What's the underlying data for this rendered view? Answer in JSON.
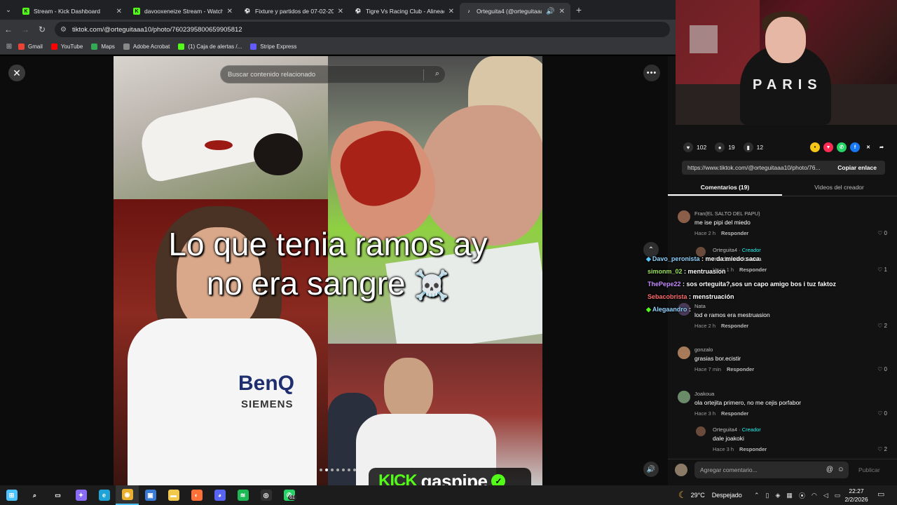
{
  "browser": {
    "tabs": [
      {
        "title": "Stream - Kick Dashboard",
        "favicon": "kick-icon",
        "color": "#53fc18",
        "active": false
      },
      {
        "title": "davooxeneize Stream - Watch L",
        "favicon": "kick-icon",
        "color": "#53fc18",
        "active": false
      },
      {
        "title": "Fixture y partidos de 07-02-202",
        "favicon": "soccer-icon",
        "color": "#3fb950",
        "active": false
      },
      {
        "title": "Tigre Vs Racing Club - Alineaci",
        "favicon": "soccer-icon",
        "color": "#3fb950",
        "active": false
      },
      {
        "title": "Orteguita4 (@orteguitaaa1(",
        "favicon": "tiktok-icon",
        "color": "#ffffff",
        "active": true
      }
    ],
    "url": "tiktok.com/@orteguitaaa10/photo/7602395800659905812",
    "bookmarks": [
      {
        "label": "Gmail",
        "color": "#ea4335"
      },
      {
        "label": "YouTube",
        "color": "#ff0000"
      },
      {
        "label": "Maps",
        "color": "#34a853"
      },
      {
        "label": "Adobe Acrobat",
        "color": "#888888"
      },
      {
        "label": "(1) Caja de alertas /...",
        "color": "#53fc18"
      },
      {
        "label": "Stripe Express",
        "color": "#635bff"
      }
    ]
  },
  "viewer": {
    "search_placeholder": "Buscar contenido relacionado",
    "caption_line1": "Lo que tenia ramos ay",
    "caption_line2": "no era sangre",
    "caption_emoji": "☠️",
    "jersey_sponsor": "BenQ",
    "jersey_sponsor2": "SIEMENS",
    "carousel_count": 7,
    "carousel_active": 1
  },
  "actions": {
    "likes": "102",
    "comments": "19",
    "saves": "12",
    "share_targets": [
      {
        "name": "coin-icon",
        "color": "#f5c518",
        "glyph": "•"
      },
      {
        "name": "tiktok-share-icon",
        "color": "#fe2c55",
        "glyph": "▼"
      },
      {
        "name": "whatsapp-icon",
        "color": "#25d366",
        "glyph": "✆"
      },
      {
        "name": "facebook-icon",
        "color": "#1877f2",
        "glyph": "f"
      },
      {
        "name": "x-icon",
        "color": "#121212",
        "glyph": "✕"
      },
      {
        "name": "forward-icon",
        "color": "#121212",
        "glyph": "➦"
      }
    ],
    "link": "https://www.tiktok.com/@orteguitaaa10/photo/76...",
    "copy_label": "Copiar enlace"
  },
  "comment_tabs": {
    "comments": "Comentarios (19)",
    "creator_videos": "Videos del creador"
  },
  "comments": [
    {
      "user": "Fran(EL SALTO DEL PAPU)",
      "text": "me ise pipi del miedo",
      "time": "Hace 2 h",
      "reply": "Responder",
      "likes": "0",
      "avatar": "#8b5e4a",
      "reply_level": 0,
      "creator": false
    },
    {
      "user": "Orteguita4",
      "creator_label": "Creador",
      "text": "me da miedo saca",
      "time": "Hace 1 h",
      "reply": "Responder",
      "likes": "1",
      "avatar": "#6a4a3a",
      "reply_level": 1,
      "creator": true
    },
    {
      "user": "Nata",
      "text": "lod e ramos era mestruasion",
      "time": "Hace 2 h",
      "reply": "Responder",
      "likes": "2",
      "avatar": "#4a3a5a",
      "reply_level": 0,
      "creator": false
    },
    {
      "user": "gonzalo",
      "text": "grasias bor.ecistir",
      "time": "Hace 7 min",
      "reply": "Responder",
      "likes": "0",
      "avatar": "#a77a5a",
      "reply_level": 0,
      "creator": false
    },
    {
      "user": "Joakoua",
      "text": "ola ortejita primero, no me cejis porfabor",
      "time": "Hace 3 h",
      "reply": "Responder",
      "likes": "0",
      "avatar": "#6a8a6a",
      "reply_level": 0,
      "creator": false
    },
    {
      "user": "Orteguita4",
      "creator_label": "Creador",
      "text": "dale joakoki",
      "time": "Hace 3 h",
      "reply": "Responder",
      "likes": "2",
      "avatar": "#6a4a3a",
      "reply_level": 1,
      "creator": true
    }
  ],
  "add_comment": {
    "placeholder": "Agregar comentario...",
    "publish": "Publicar"
  },
  "stream_chat": [
    {
      "user": "Davo_peronista",
      "message": "me da miedo saca",
      "color": "#8fd4ff",
      "badge": "#53c8ff"
    },
    {
      "user": "simonm_02",
      "message": "mentruasion",
      "color": "#9be35f",
      "badge": ""
    },
    {
      "user": "ThePepe22",
      "message": "sos orteguita?,sos un capo amigo bos i tuz faktoz",
      "color": "#c58cff",
      "badge": ""
    },
    {
      "user": "Sebacobrista",
      "message": "menstruación",
      "color": "#ff6b6b",
      "badge": ""
    },
    {
      "user": "Alegaandro",
      "message": "",
      "color": "#8fd4ff",
      "badge": "#53fc18"
    }
  ],
  "kick_overlay": {
    "brand": "KICK",
    "channel": "gaspipe",
    "brand_color": "#53fc18"
  },
  "taskbar": {
    "apps": [
      {
        "name": "start-icon",
        "color": "#4cc2ff",
        "glyph": "⊞"
      },
      {
        "name": "search-icon",
        "color": "transparent",
        "glyph": "⌕"
      },
      {
        "name": "task-view-icon",
        "color": "transparent",
        "glyph": "▭"
      },
      {
        "name": "copilot-icon",
        "color": "#8a6bf5",
        "glyph": "✦"
      },
      {
        "name": "edge-icon",
        "color": "#1fa2d6",
        "glyph": "e"
      },
      {
        "name": "chrome-icon",
        "color": "#e8b02c",
        "glyph": "◉"
      },
      {
        "name": "store-icon",
        "color": "#3a7bd5",
        "glyph": "▣"
      },
      {
        "name": "explorer-icon",
        "color": "#f2c94c",
        "glyph": "▬"
      },
      {
        "name": "firefox-icon",
        "color": "#ff7139",
        "glyph": "◐"
      },
      {
        "name": "discord-icon",
        "color": "#5865f2",
        "glyph": "◕"
      },
      {
        "name": "spotify-icon",
        "color": "#1db954",
        "glyph": "≋"
      },
      {
        "name": "obs-icon",
        "color": "#303030",
        "glyph": "◎"
      },
      {
        "name": "whatsapp-icon",
        "color": "#25d366",
        "glyph": "✆"
      }
    ],
    "whatsapp_badge": "61",
    "temperature": "29°C",
    "weather": "Despejado",
    "time": "22:27",
    "date": "2/2/2026"
  }
}
